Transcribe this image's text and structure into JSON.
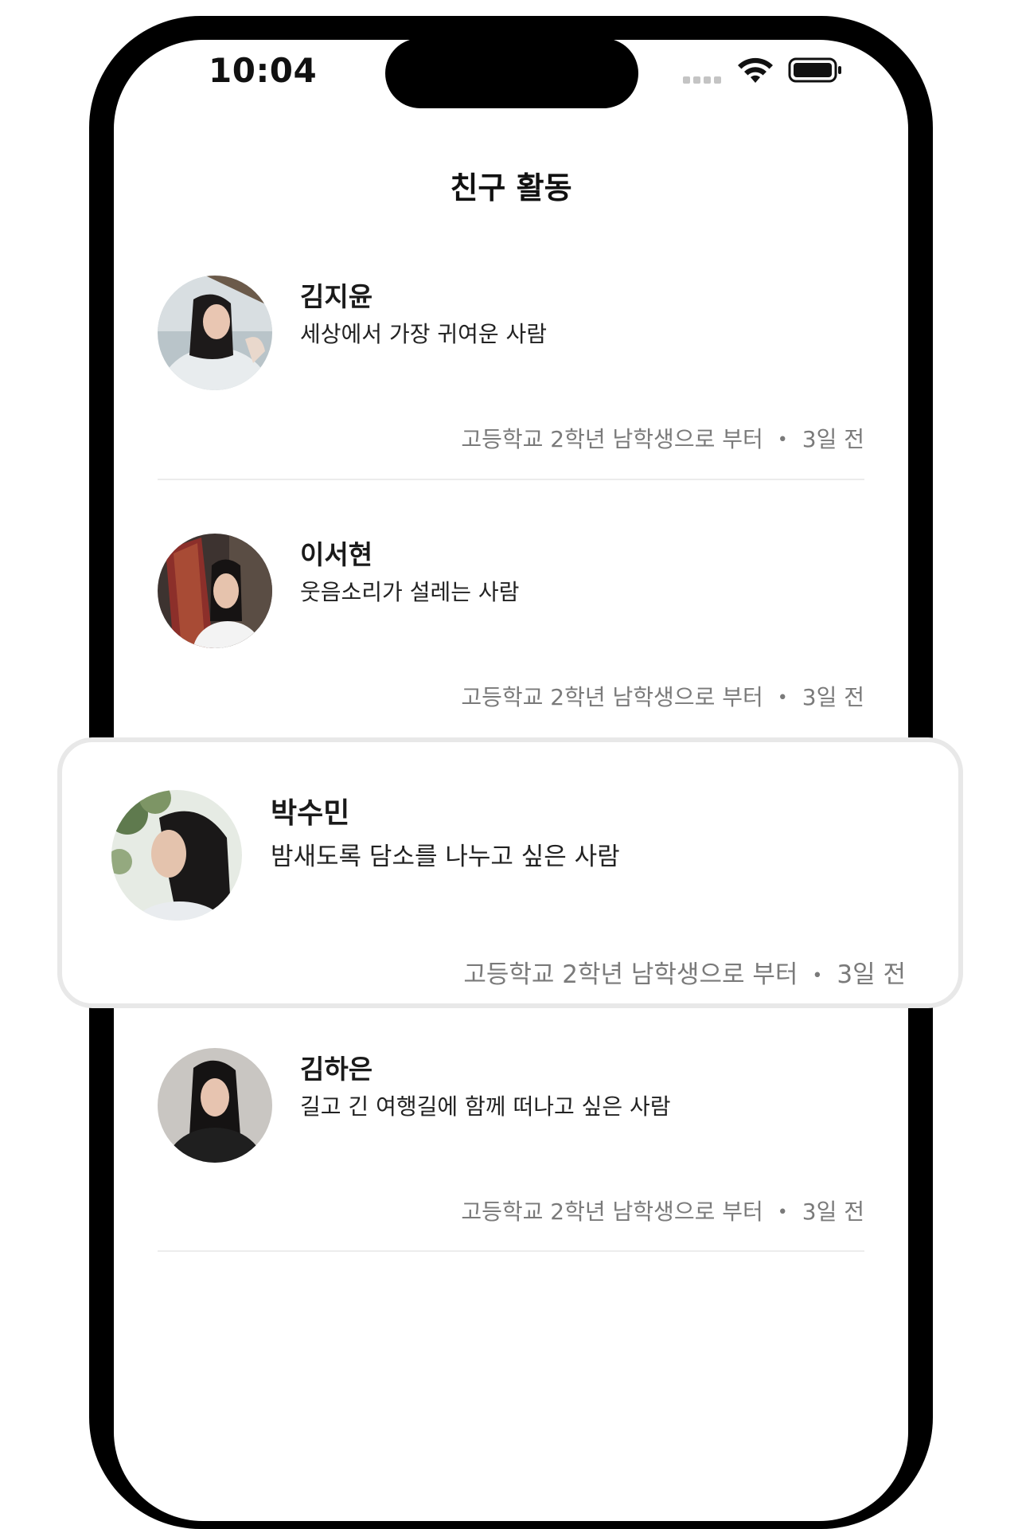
{
  "status_bar": {
    "time": "10:04"
  },
  "header": {
    "title": "친구 활동"
  },
  "activities": [
    {
      "name": "김지윤",
      "description": "세상에서 가장 귀여운 사람",
      "source": "고등학교 2학년 남학생으로 부터",
      "time_ago": "3일 전"
    },
    {
      "name": "이서현",
      "description": "웃음소리가 설레는 사람",
      "source": "고등학교 2학년 남학생으로 부터",
      "time_ago": "3일 전"
    },
    {
      "name": "박수민",
      "description": "밤새도록 담소를 나누고 싶은 사람",
      "source": "고등학교 2학년 남학생으로 부터",
      "time_ago": "3일 전"
    },
    {
      "name": "김하은",
      "description": "길고 긴 여행길에 함께 떠나고 싶은 사람",
      "source": "고등학교 2학년 남학생으로 부터",
      "time_ago": "3일 전"
    }
  ],
  "meta_separator": "•"
}
